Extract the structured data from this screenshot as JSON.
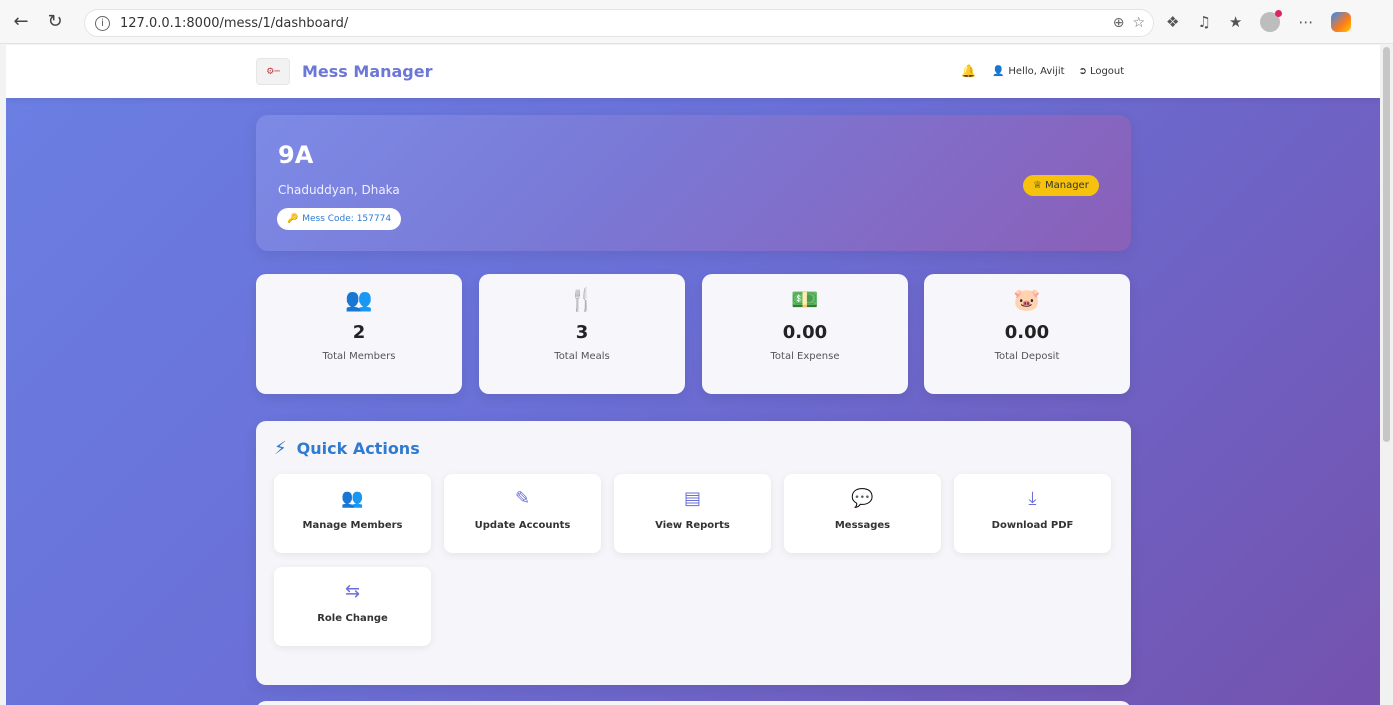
{
  "browser": {
    "url": "127.0.0.1:8000/mess/1/dashboard/"
  },
  "navbar": {
    "brand": "Mess Manager",
    "greeting": "Hello, Avijit",
    "logout": "Logout"
  },
  "hero": {
    "mess_name": "9A",
    "address": "Chaduddyan, Dhaka",
    "mess_code": "Mess Code: 157774",
    "role": "Manager"
  },
  "stats": [
    {
      "icon": "users-icon",
      "value": "2",
      "label": "Total Members"
    },
    {
      "icon": "utensils-icon",
      "value": "3",
      "label": "Total Meals"
    },
    {
      "icon": "money-icon",
      "value": "0.00",
      "label": "Total Expense"
    },
    {
      "icon": "piggy-bank-icon",
      "value": "0.00",
      "label": "Total Deposit"
    }
  ],
  "quick_actions": {
    "title": "Quick Actions",
    "items": [
      {
        "icon": "users-icon",
        "label": "Manage Members"
      },
      {
        "icon": "edit-icon",
        "label": "Update Accounts"
      },
      {
        "icon": "chart-icon",
        "label": "View Reports"
      },
      {
        "icon": "comments-icon",
        "label": "Messages"
      },
      {
        "icon": "download-icon",
        "label": "Download PDF"
      },
      {
        "icon": "exchange-icon",
        "label": "Role Change"
      }
    ]
  },
  "colors": {
    "brand": "#6b78d8",
    "accent_blue": "#2f7bd0",
    "manager_badge": "#f6c20e",
    "icon": "#6b6fd6"
  }
}
